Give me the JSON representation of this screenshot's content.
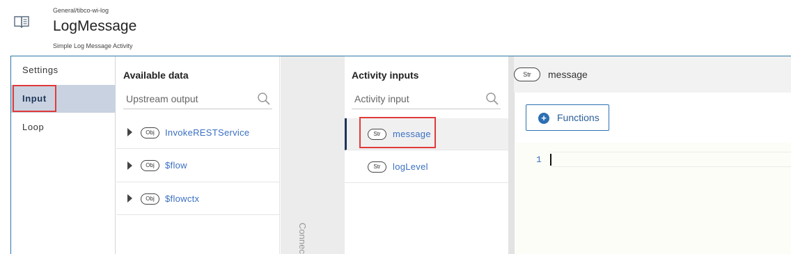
{
  "header": {
    "category": "General/tibco-wi-log",
    "title": "LogMessage",
    "subtitle": "Simple Log Message Activity",
    "icon": "book-icon"
  },
  "tabs": [
    {
      "label": "Settings",
      "active": false
    },
    {
      "label": "Input",
      "active": true
    },
    {
      "label": "Loop",
      "active": false
    }
  ],
  "available_data": {
    "title": "Available data",
    "search_placeholder": "Upstream output",
    "items": [
      {
        "type": "Obj",
        "label": "InvokeRESTService"
      },
      {
        "type": "Obj",
        "label": "$flow"
      },
      {
        "type": "Obj",
        "label": "$flowctx"
      }
    ]
  },
  "connector": {
    "label": "Connec"
  },
  "activity_inputs": {
    "title": "Activity inputs",
    "search_placeholder": "Activity input",
    "items": [
      {
        "type": "Str",
        "label": "message",
        "selected": true
      },
      {
        "type": "Str",
        "label": "logLevel",
        "selected": false
      }
    ]
  },
  "editor": {
    "field_type": "Str",
    "field_name": "message",
    "functions_label": "Functions",
    "line_number": "1",
    "code": ""
  },
  "colors": {
    "accent": "#2c6fb4",
    "active_tab_bg": "#c9d2e0",
    "highlight": "#e03a3a",
    "link": "#3a6fc2"
  }
}
